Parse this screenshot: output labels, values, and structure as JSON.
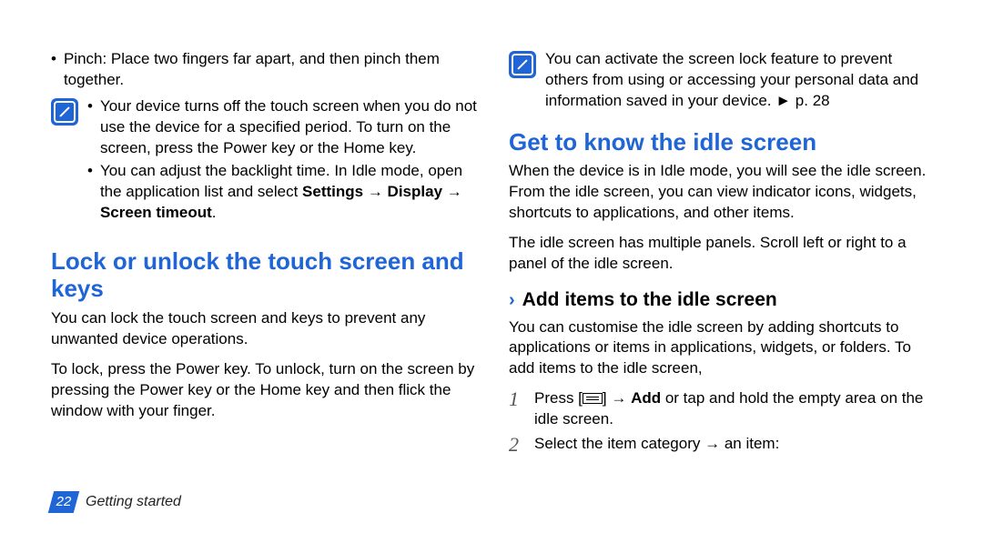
{
  "left": {
    "pinch": "Pinch: Place two fingers far apart, and then pinch them together.",
    "note1": "Your device turns off the touch screen when you do not use the device for a specified period. To turn on the screen, press the Power key or the Home key.",
    "note2_pre": "You can adjust the backlight time. In Idle mode, open the application list and select ",
    "note2_bold": "Settings → Display → Screen timeout",
    "note2_post": ".",
    "h2": "Lock or unlock the touch screen and keys",
    "p1": "You can lock the touch screen and keys to prevent any unwanted device operations.",
    "p2": "To lock, press the Power key. To unlock, turn on the screen by pressing the Power key or the Home key and then flick the window with your finger."
  },
  "right": {
    "note": "You can activate the screen lock feature to prevent others from using or accessing your personal data and information saved in your device. ► p. 28",
    "h2": "Get to know the idle screen",
    "p1": "When the device is in Idle mode, you will see the idle screen. From the idle screen, you can view indicator icons, widgets, shortcuts to applications, and other items.",
    "p2": "The idle screen has multiple panels. Scroll left or right to a panel of the idle screen.",
    "sub": "Add items to the idle screen",
    "p3": "You can customise the idle screen by adding shortcuts to applications or items in applications, widgets, or folders. To add items to the idle screen,",
    "step1_pre": "Press [",
    "step1_mid": "] → ",
    "step1_bold": "Add",
    "step1_post": " or tap and hold the empty area on the idle screen.",
    "step2": "Select the item category → an item:"
  },
  "footer": {
    "page": "22",
    "section": "Getting started"
  }
}
